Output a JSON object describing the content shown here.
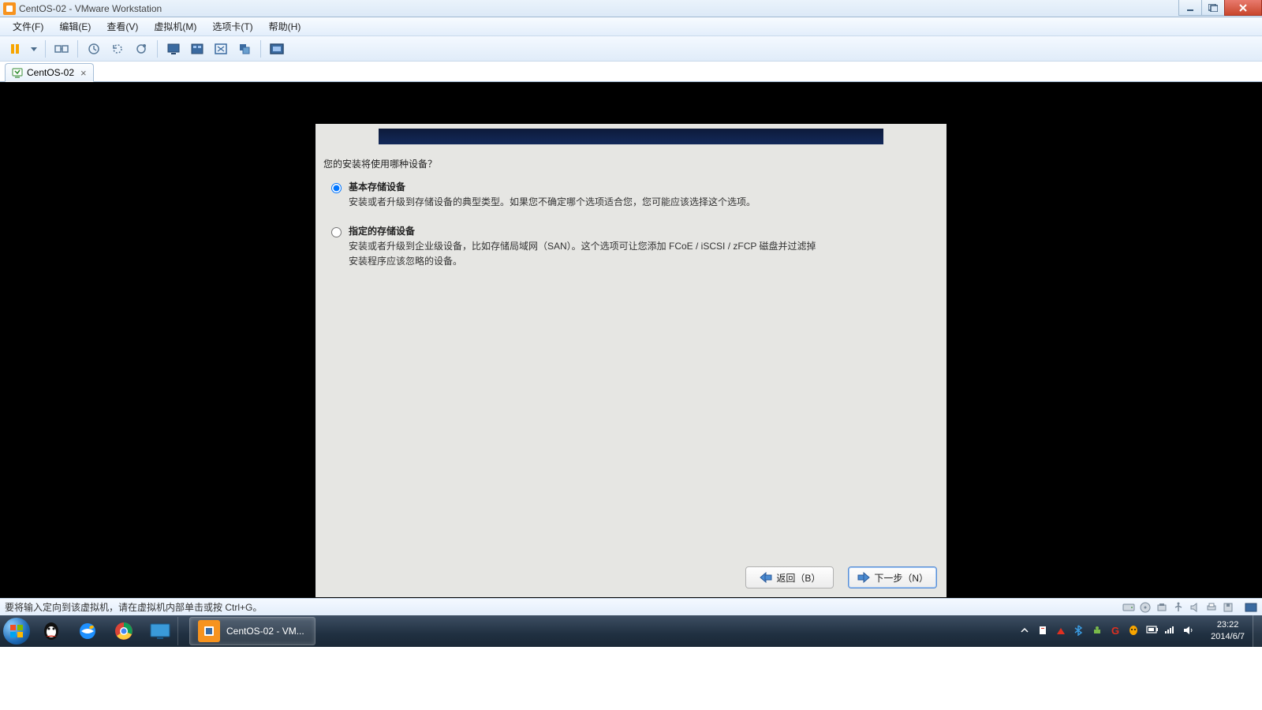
{
  "window": {
    "title": "CentOS-02 - VMware Workstation"
  },
  "menu": {
    "file": "文件(F)",
    "edit": "编辑(E)",
    "view": "查看(V)",
    "vm": "虚拟机(M)",
    "tabs": "选项卡(T)",
    "help": "帮助(H)"
  },
  "tab": {
    "label": "CentOS-02",
    "close": "×"
  },
  "installer": {
    "question": "您的安装将使用哪种设备？",
    "opt1_title": "基本存储设备",
    "opt1_desc": "安装或者升级到存储设备的典型类型。如果您不确定哪个选项适合您，您可能应该选择这个选项。",
    "opt2_title": "指定的存储设备",
    "opt2_desc": "安装或者升级到企业级设备，比如存储局域网（SAN）。这个选项可让您添加 FCoE / iSCSI / zFCP 磁盘并过滤掉安装程序应该忽略的设备。",
    "back": "返回（B）",
    "next": "下一步（N）"
  },
  "statusbar": {
    "hint": "要将输入定向到该虚拟机，请在虚拟机内部单击或按 Ctrl+G。"
  },
  "taskbar": {
    "running": "CentOS-02 - VM..."
  },
  "clock": {
    "time": "23:22",
    "date": "2014/6/7"
  }
}
